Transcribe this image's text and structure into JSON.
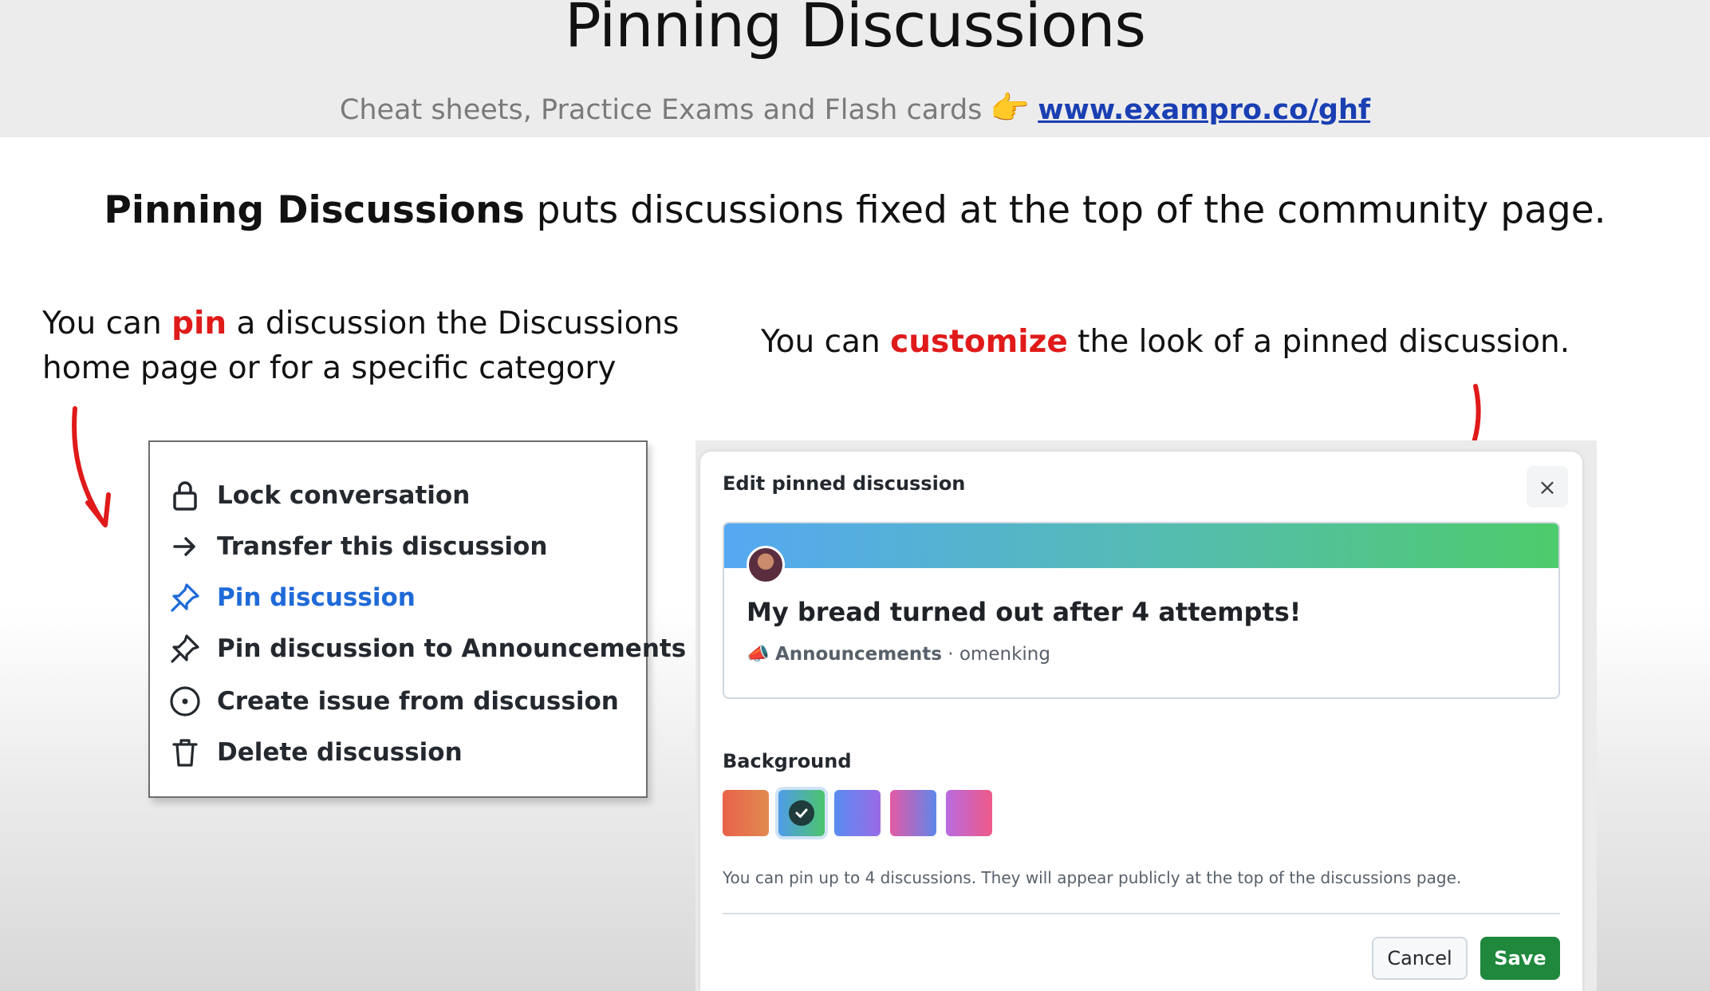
{
  "header": {
    "title": "Pinning Discussions",
    "subtitle_text": "Cheat sheets, Practice Exams and Flash cards",
    "subtitle_emoji": "👉",
    "subtitle_link": "www.exampro.co/ghf"
  },
  "lead": {
    "bold": "Pinning Discussions",
    "rest": " puts discussions fixed at the top of the community page."
  },
  "note_left": {
    "before": "You can ",
    "highlight": "pin",
    "after": " a discussion the Discussions home page or for a specific category"
  },
  "note_right": {
    "before": "You can ",
    "highlight": "customize",
    "after": " the look of a pinned discussion."
  },
  "menu": {
    "items": [
      {
        "label": "Lock conversation",
        "icon": "lock-icon"
      },
      {
        "label": "Transfer this discussion",
        "icon": "arrow-right-icon"
      },
      {
        "label": "Pin discussion",
        "icon": "pin-icon"
      },
      {
        "label": "Pin discussion to Announcements",
        "icon": "pin-icon"
      },
      {
        "label": "Create issue from discussion",
        "icon": "issue-opened-icon"
      },
      {
        "label": "Delete discussion",
        "icon": "trash-icon"
      }
    ]
  },
  "dialog": {
    "title": "Edit pinned discussion",
    "close": "×",
    "preview": {
      "title": "My bread turned out after 4 attempts!",
      "category_emoji": "📣",
      "category": "Announcements",
      "separator": " · ",
      "author": "omenking"
    },
    "background_label": "Background",
    "swatches": [
      "orange-red",
      "blue-green",
      "blue-purple",
      "pink-blue",
      "pink-purple"
    ],
    "selected_swatch": "blue-green",
    "hint": "You can pin up to 4 discussions. They will appear publicly at the top of the discussions page.",
    "cancel_label": "Cancel",
    "save_label": "Save"
  },
  "colors": {
    "accent_red": "#e01a1a",
    "link_blue": "#1a3fb3",
    "active_blue": "#1f6ad8",
    "save_green": "#1f883d"
  }
}
